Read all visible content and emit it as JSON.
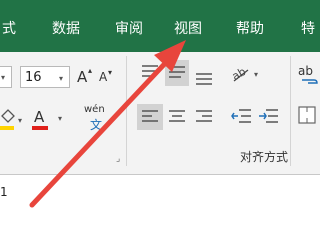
{
  "tabs": [
    "式",
    "数据",
    "审阅",
    "视图",
    "帮助",
    "特"
  ],
  "font": {
    "size": "16",
    "grow": "A",
    "shrink": "A",
    "phonetic_top": "wén",
    "phonetic_bottom": "文"
  },
  "alignment": {
    "group_label": "对齐方式"
  },
  "wrap": {
    "label": "ab"
  },
  "colors": {
    "tab_bar": "#217346",
    "ribbon": "#f3f3f3",
    "font_red": "#e0201a",
    "highlight": "#ffd400",
    "arrow": "#e8453c"
  },
  "name_box": {
    "value": "1"
  }
}
